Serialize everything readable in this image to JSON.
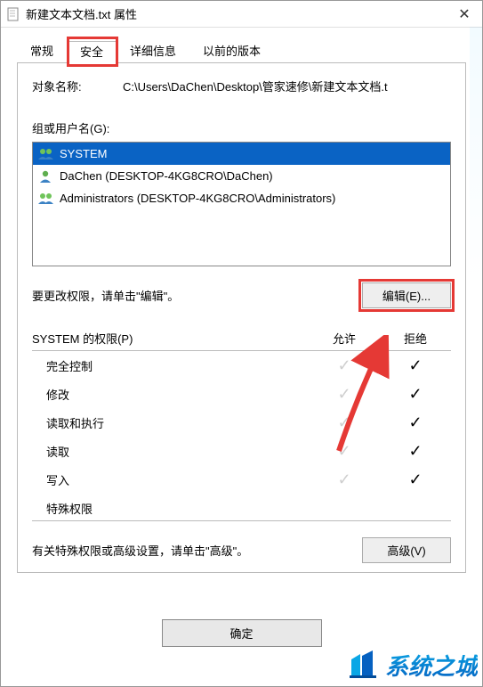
{
  "titlebar": {
    "title": "新建文本文档.txt 属性"
  },
  "tabs": {
    "list": [
      {
        "label": "常规",
        "active": false
      },
      {
        "label": "安全",
        "active": true
      },
      {
        "label": "详细信息",
        "active": false
      },
      {
        "label": "以前的版本",
        "active": false
      }
    ]
  },
  "object": {
    "label": "对象名称:",
    "value": "C:\\Users\\DaChen\\Desktop\\管家速修\\新建文本文档.t"
  },
  "users_label": "组或用户名(G):",
  "users": [
    {
      "name": "SYSTEM",
      "icon": "group",
      "selected": true
    },
    {
      "name": "DaChen (DESKTOP-4KG8CRO\\DaChen)",
      "icon": "user",
      "selected": false
    },
    {
      "name": "Administrators (DESKTOP-4KG8CRO\\Administrators)",
      "icon": "group",
      "selected": false
    }
  ],
  "edit_row": {
    "hint": "要更改权限，请单击\"编辑\"。",
    "button": "编辑(E)..."
  },
  "perms": {
    "header_label": "SYSTEM 的权限(P)",
    "col_allow": "允许",
    "col_deny": "拒绝",
    "rows": [
      {
        "label": "完全控制",
        "allow": true,
        "deny": true
      },
      {
        "label": "修改",
        "allow": true,
        "deny": true
      },
      {
        "label": "读取和执行",
        "allow": true,
        "deny": true
      },
      {
        "label": "读取",
        "allow": true,
        "deny": true
      },
      {
        "label": "写入",
        "allow": true,
        "deny": true
      },
      {
        "label": "特殊权限",
        "allow": false,
        "deny": false
      }
    ]
  },
  "advanced_row": {
    "hint": "有关特殊权限或高级设置，请单击\"高级\"。",
    "button": "高级(V)"
  },
  "footer": {
    "ok": "确定"
  },
  "watermark": {
    "text": "系统之城"
  }
}
